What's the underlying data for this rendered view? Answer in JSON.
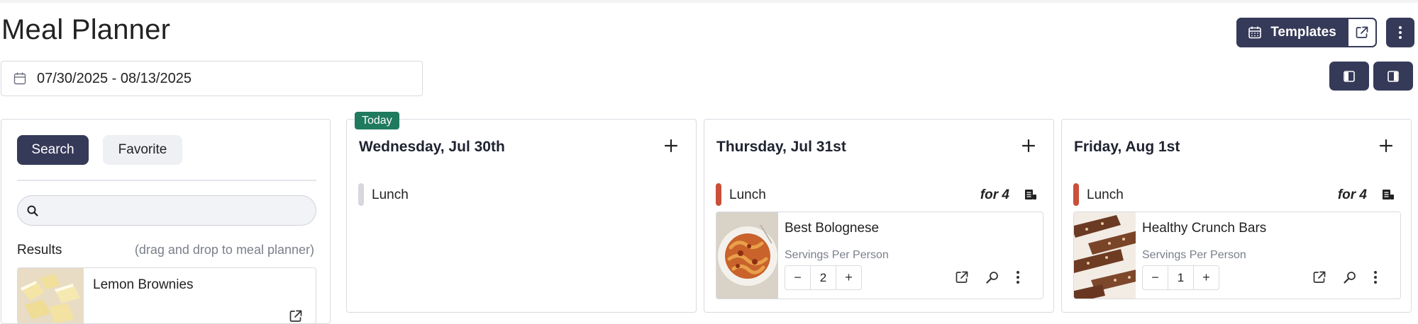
{
  "page": {
    "title": "Meal Planner"
  },
  "header": {
    "templates_label": "Templates",
    "icons": {
      "calendar": "calendar-icon",
      "external": "external-link-icon",
      "more": "more-vertical-icon"
    }
  },
  "date_range": {
    "value": "07/30/2025 - 08/13/2025"
  },
  "side": {
    "tabs": [
      {
        "label": "Search",
        "active": true
      },
      {
        "label": "Favorite",
        "active": false
      }
    ],
    "search": {
      "value": "",
      "placeholder": ""
    },
    "results_label": "Results",
    "results_hint": "(drag and drop to meal planner)",
    "results": [
      {
        "name": "Lemon Brownies"
      }
    ]
  },
  "days": [
    {
      "title": "Wednesday, Jul 30th",
      "badge": "Today",
      "meal": {
        "label": "Lunch",
        "for": "",
        "bar_color": "#d6d8dd"
      }
    },
    {
      "title": "Thursday, Jul 31st",
      "badge": "",
      "meal": {
        "label": "Lunch",
        "for": "for 4",
        "bar_color": "#c9503a"
      },
      "entry": {
        "name": "Best Bolognese",
        "sub": "Servings Per Person",
        "servings": "2"
      }
    },
    {
      "title": "Friday, Aug 1st",
      "badge": "",
      "meal": {
        "label": "Lunch",
        "for": "for 4",
        "bar_color": "#c9503a"
      },
      "entry": {
        "name": "Healthy Crunch Bars",
        "sub": "Servings Per Person",
        "servings": "1"
      }
    }
  ],
  "colors": {
    "primary": "#363a59",
    "today": "#1f7a5e",
    "meal_bar": "#c9503a",
    "border": "#d9dbe0"
  }
}
